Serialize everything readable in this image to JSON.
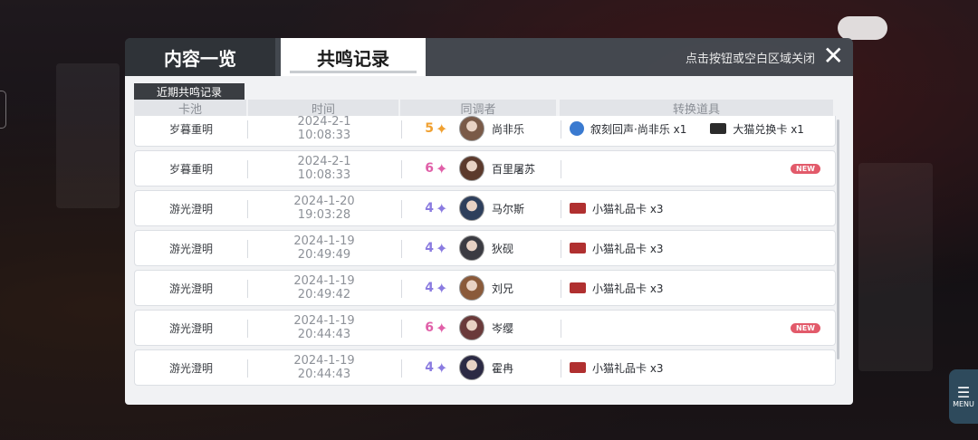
{
  "tabs": {
    "overview": "内容一览",
    "records": "共鸣记录"
  },
  "close_hint": "点击按钮或空白区域关闭",
  "close_symbol": "✕",
  "section_label": "近期共鸣记录",
  "columns": {
    "pool": "卡池",
    "time": "时间",
    "character": "同调者",
    "items": "转换道具"
  },
  "menu_label": "MENU",
  "new_badge": "NEW",
  "colors": {
    "rarity5": "#f0a030",
    "rarity6": "#e05fa8",
    "rarity4": "#8a7be0"
  },
  "rows": [
    {
      "pool": "岁暮重明",
      "date": "2024-2-1",
      "time": "10:08:33",
      "rarity": "5",
      "rarity_color": "#f0a030",
      "star": "✦",
      "name": "尚非乐",
      "avatar_color": "#7a5a48",
      "items": [
        {
          "icon": "sphere-icon",
          "label": "叙刻回声·尚非乐 x1",
          "color": "#3a7ad0"
        },
        {
          "icon": "card-icon",
          "label": "大猫兑换卡 x1",
          "color": "#2b2b2b"
        }
      ],
      "new": false
    },
    {
      "pool": "岁暮重明",
      "date": "2024-2-1",
      "time": "10:08:33",
      "rarity": "6",
      "rarity_color": "#e05fa8",
      "star": "✦",
      "name": "百里屠苏",
      "avatar_color": "#5c3a2c",
      "items": [],
      "new": true
    },
    {
      "pool": "游光澄明",
      "date": "2024-1-20",
      "time": "19:03:28",
      "rarity": "4",
      "rarity_color": "#8a7be0",
      "star": "✦",
      "name": "马尔斯",
      "avatar_color": "#2e3f5c",
      "items": [
        {
          "icon": "gift-card-icon",
          "label": "小猫礼品卡 x3",
          "color": "#b03030"
        }
      ],
      "new": false
    },
    {
      "pool": "游光澄明",
      "date": "2024-1-19",
      "time": "20:49:49",
      "rarity": "4",
      "rarity_color": "#8a7be0",
      "star": "✦",
      "name": "狄砚",
      "avatar_color": "#3b3b42",
      "items": [
        {
          "icon": "gift-card-icon",
          "label": "小猫礼品卡 x3",
          "color": "#b03030"
        }
      ],
      "new": false
    },
    {
      "pool": "游光澄明",
      "date": "2024-1-19",
      "time": "20:49:42",
      "rarity": "4",
      "rarity_color": "#8a7be0",
      "star": "✦",
      "name": "刘兄",
      "avatar_color": "#8a5a3a",
      "items": [
        {
          "icon": "gift-card-icon",
          "label": "小猫礼品卡 x3",
          "color": "#b03030"
        }
      ],
      "new": false
    },
    {
      "pool": "游光澄明",
      "date": "2024-1-19",
      "time": "20:44:43",
      "rarity": "6",
      "rarity_color": "#e05fa8",
      "star": "✦",
      "name": "岑缨",
      "avatar_color": "#6a3a3a",
      "items": [],
      "new": true
    },
    {
      "pool": "游光澄明",
      "date": "2024-1-19",
      "time": "20:44:43",
      "rarity": "4",
      "rarity_color": "#8a7be0",
      "star": "✦",
      "name": "霍冉",
      "avatar_color": "#2c2a44",
      "items": [
        {
          "icon": "gift-card-icon",
          "label": "小猫礼品卡 x3",
          "color": "#b03030"
        }
      ],
      "new": false
    }
  ]
}
